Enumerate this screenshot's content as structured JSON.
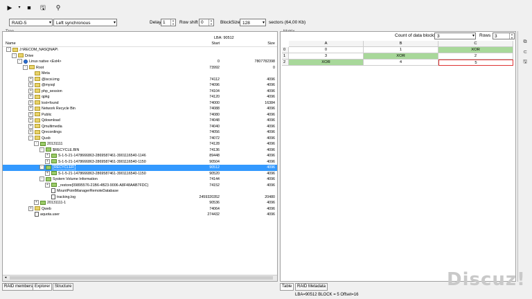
{
  "toolbar": {
    "play_icon": "play-icon",
    "dropdown_icon": "chevron-down-icon",
    "stop_icon": "stop-icon",
    "save_icon": "save-icon",
    "tree_icon": "tree-icon"
  },
  "controls": {
    "raid_type": "RAID-5",
    "layout": "Left synchronous",
    "delay_label": "Delay",
    "delay_value": "1",
    "row_shift_label": "Row shift",
    "row_shift_value": "0",
    "block_size_label": "BlockSize",
    "block_size_value": "128",
    "sectors_text": "sectors (64,00 Kb)"
  },
  "tree": {
    "caption": "Tree",
    "lba_text": "LBA: 90512",
    "col_name": "Name",
    "col_start": "Start",
    "col_size": "Size",
    "rows": [
      {
        "exp": "-",
        "icon": "folder-icon",
        "ind": 0,
        "name": "J:\\RECOM_NASQNAP\\",
        "start": "",
        "size": "",
        "sel": false
      },
      {
        "exp": "-",
        "icon": "folder-icon",
        "ind": 1,
        "name": "Drive",
        "start": "",
        "size": "",
        "sel": false
      },
      {
        "exp": "-",
        "icon": "info-icon",
        "ind": 2,
        "name": "Linux native <Ext4>",
        "start": "0",
        "size": "7807782398",
        "sel": false
      },
      {
        "exp": "-",
        "icon": "folder-icon",
        "ind": 3,
        "name": "Root",
        "start": "73992",
        "size": "0",
        "sel": false
      },
      {
        "exp": "",
        "icon": "folder-icon",
        "ind": 4,
        "name": "Meta",
        "start": "",
        "size": "",
        "sel": false
      },
      {
        "exp": "+",
        "icon": "folder-icon",
        "ind": 4,
        "name": "@iscsi.img",
        "start": "74112",
        "size": "4096",
        "sel": false
      },
      {
        "exp": "+",
        "icon": "folder-icon",
        "ind": 4,
        "name": "@mysql",
        "start": "74096",
        "size": "4096",
        "sel": false
      },
      {
        "exp": "+",
        "icon": "folder-icon",
        "ind": 4,
        "name": "php_session",
        "start": "74104",
        "size": "4096",
        "sel": false
      },
      {
        "exp": "+",
        "icon": "folder-icon",
        "ind": 4,
        "name": "qpkg",
        "start": "74120",
        "size": "4096",
        "sel": false
      },
      {
        "exp": "+",
        "icon": "folder-icon",
        "ind": 4,
        "name": "lost+found",
        "start": "74000",
        "size": "16384",
        "sel": false
      },
      {
        "exp": "+",
        "icon": "folder-icon",
        "ind": 4,
        "name": "Network Recycle Bin",
        "start": "74088",
        "size": "4096",
        "sel": false
      },
      {
        "exp": "+",
        "icon": "folder-icon",
        "ind": 4,
        "name": "Public",
        "start": "74080",
        "size": "4096",
        "sel": false
      },
      {
        "exp": "+",
        "icon": "folder-icon",
        "ind": 4,
        "name": "Qdownload",
        "start": "74048",
        "size": "4096",
        "sel": false
      },
      {
        "exp": "+",
        "icon": "folder-icon",
        "ind": 4,
        "name": "Qmultimedia",
        "start": "74040",
        "size": "4096",
        "sel": false
      },
      {
        "exp": "+",
        "icon": "folder-icon",
        "ind": 4,
        "name": "Qrecordings",
        "start": "74056",
        "size": "4096",
        "sel": false
      },
      {
        "exp": "-",
        "icon": "folder-icon",
        "ind": 4,
        "name": "Qusb",
        "start": "74072",
        "size": "4096",
        "sel": false
      },
      {
        "exp": "-",
        "icon": "folder-icon",
        "ind": 5,
        "name": "20131111",
        "start": "74128",
        "size": "4096",
        "sel": false
      },
      {
        "exp": "-",
        "icon": "folder-icon",
        "ind": 6,
        "name": "$RECYCLE.BIN",
        "start": "74136",
        "size": "4096",
        "sel": false
      },
      {
        "exp": "+",
        "icon": "folder-icon",
        "ind": 7,
        "name": "S-1-5-21-1478666863-2869587461-3901116540-1146",
        "start": "89448",
        "size": "4096",
        "sel": false
      },
      {
        "exp": "+",
        "icon": "folder-icon",
        "ind": 7,
        "name": "S-1-5-21-1478666863-2869587461-3901116540-1150",
        "start": "90504",
        "size": "4096",
        "sel": false
      },
      {
        "exp": "-",
        "icon": "folder-icon",
        "ind": 6,
        "name": "RECYCLER",
        "start": "90512",
        "size": "4096",
        "sel": true
      },
      {
        "exp": "+",
        "icon": "folder-icon",
        "ind": 7,
        "name": "S-1-5-21-1478666863-2869587461-3901116540-1150",
        "start": "90520",
        "size": "4096",
        "sel": false
      },
      {
        "exp": "-",
        "icon": "folder-icon",
        "ind": 6,
        "name": "System Volume Information",
        "start": "74144",
        "size": "4096",
        "sel": false
      },
      {
        "exp": "+",
        "icon": "folder-icon",
        "ind": 7,
        "name": "_restore{09895576-21B6-4B23-9006-A8F48AAB7FDC}",
        "start": "74152",
        "size": "4096",
        "sel": false
      },
      {
        "exp": "",
        "icon": "file-icon",
        "ind": 7,
        "name": "MountPointManagerRemoteDatabase",
        "start": "",
        "size": "",
        "sel": false
      },
      {
        "exp": "",
        "icon": "file-icon",
        "ind": 7,
        "name": "tracking.log",
        "start": "2459320352",
        "size": "20480",
        "sel": false
      },
      {
        "exp": "+",
        "icon": "folder-icon",
        "ind": 5,
        "name": "20131111-1",
        "start": "90536",
        "size": "4096",
        "sel": false
      },
      {
        "exp": "+",
        "icon": "folder-icon",
        "ind": 4,
        "name": "Qweb",
        "start": "74064",
        "size": "4096",
        "sel": false
      },
      {
        "exp": "",
        "icon": "file-icon",
        "ind": 4,
        "name": "aquota.user",
        "start": "274432",
        "size": "4096",
        "sel": false
      }
    ],
    "tabs": [
      "RAID members",
      "Explorer",
      "Structure"
    ]
  },
  "matrix": {
    "caption": "Matrix",
    "count_label": "Count of data blocks",
    "count_value": "3",
    "rows_label": "Rows",
    "rows_value": "3",
    "columns": [
      "A",
      "B",
      "C"
    ],
    "rows": [
      {
        "id": "0",
        "cells": [
          {
            "v": "0",
            "xor": false,
            "red": false
          },
          {
            "v": "1",
            "xor": false,
            "red": false
          },
          {
            "v": "XOR",
            "xor": true,
            "red": false
          }
        ]
      },
      {
        "id": "1",
        "cells": [
          {
            "v": "3",
            "xor": false,
            "red": false
          },
          {
            "v": "XOR",
            "xor": true,
            "red": false
          },
          {
            "v": "2",
            "xor": false,
            "red": false
          }
        ]
      },
      {
        "id": "2",
        "cells": [
          {
            "v": "XOR",
            "xor": true,
            "red": false
          },
          {
            "v": "4",
            "xor": false,
            "red": false
          },
          {
            "v": "5",
            "xor": false,
            "red": true
          }
        ]
      }
    ],
    "tabs": [
      "Table",
      "RAID Metadata"
    ]
  },
  "status": "LBA=90512 BLOCK = 5 Offset=16",
  "watermark": "Discuz!"
}
